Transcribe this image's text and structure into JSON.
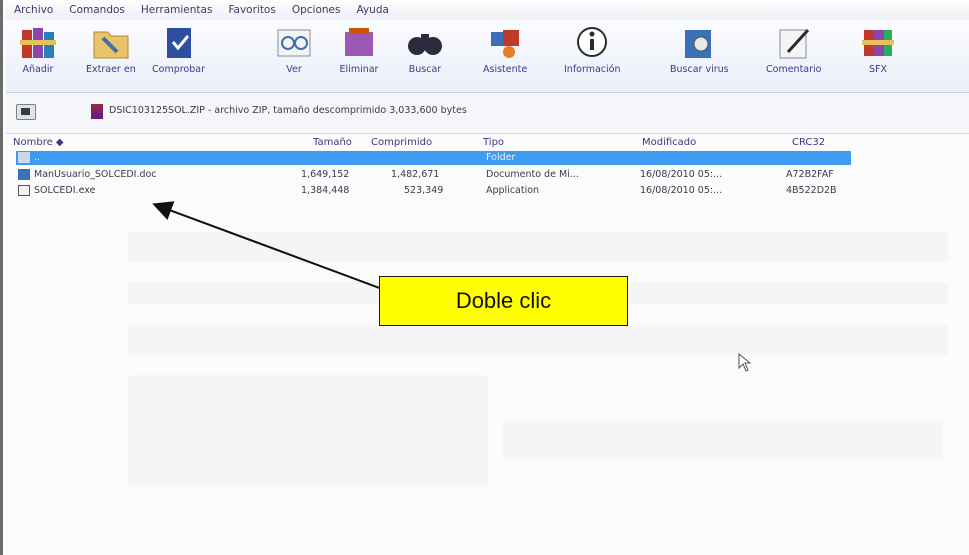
{
  "menu": [
    "Archivo",
    "Comandos",
    "Herramientas",
    "Favoritos",
    "Opciones",
    "Ayuda"
  ],
  "toolbar": [
    {
      "label": "Añadir",
      "icon": "add-books-icon"
    },
    {
      "label": "Extraer en",
      "icon": "extract-folder-icon"
    },
    {
      "label": "Comprobar",
      "icon": "test-book-icon"
    },
    {
      "label": "Ver",
      "icon": "view-glasses-icon"
    },
    {
      "label": "Eliminar",
      "icon": "delete-icon"
    },
    {
      "label": "Buscar",
      "icon": "binoculars-icon"
    },
    {
      "label": "Asistente",
      "icon": "wizard-icon"
    },
    {
      "label": "Información",
      "icon": "info-icon"
    },
    {
      "label": "Buscar virus",
      "icon": "virus-scan-icon"
    },
    {
      "label": "Comentario",
      "icon": "comment-icon"
    },
    {
      "label": "SFX",
      "icon": "sfx-icon"
    }
  ],
  "address": {
    "path": "DSIC103125SOL.ZIP - archivo ZIP, tamaño descomprimido 3,033,600 bytes"
  },
  "columns": {
    "name": "Nombre",
    "size": "Tamaño",
    "packed": "Comprimido",
    "type": "Tipo",
    "modified": "Modificado",
    "crc": "CRC32"
  },
  "rows": [
    {
      "name": "..",
      "size": "",
      "packed": "",
      "type": "Folder",
      "modified": "",
      "crc": "",
      "selected": true
    },
    {
      "name": "ManUsuario_SOLCEDI.doc",
      "size": "1,649,152",
      "packed": "1,482,671",
      "type": "Documento de Mi...",
      "modified": "16/08/2010 05:...",
      "crc": "A72B2FAF",
      "selected": false
    },
    {
      "name": "SOLCEDI.exe",
      "size": "1,384,448",
      "packed": "523,349",
      "type": "Application",
      "modified": "16/08/2010 05:...",
      "crc": "4B522D2B",
      "selected": false
    }
  ],
  "callout": {
    "text": "Doble clic"
  },
  "colors": {
    "selection": "#3d9bf0",
    "callout": "#ffff00"
  }
}
